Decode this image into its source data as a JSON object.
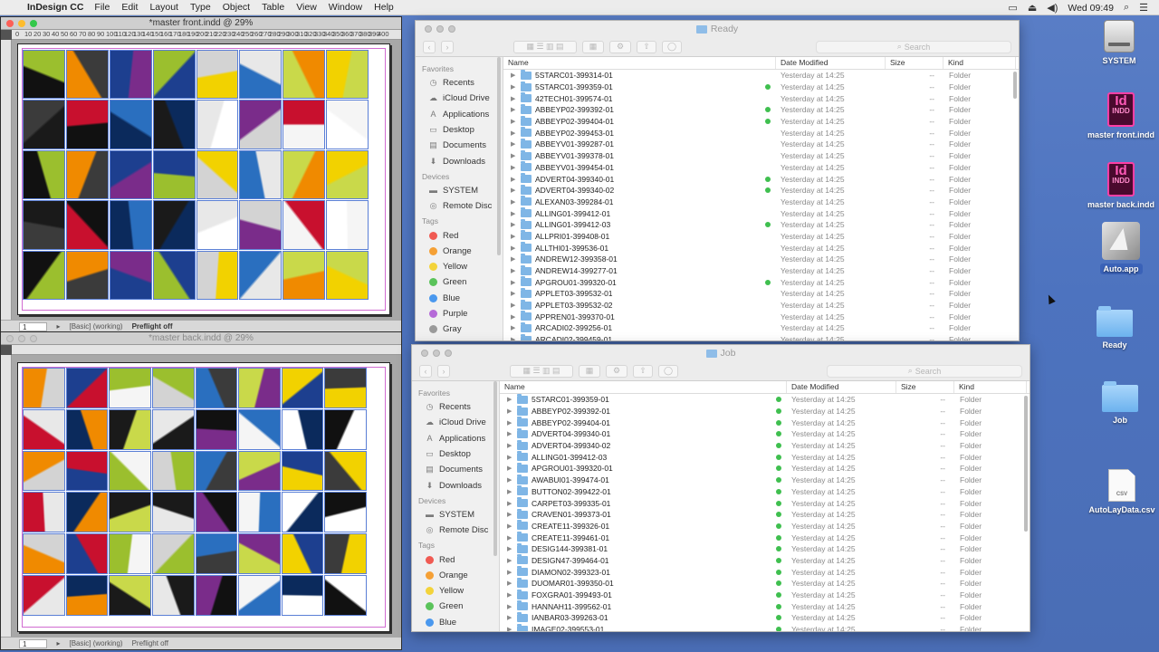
{
  "menubar": {
    "apple_icon": "apple-icon",
    "app_name": "InDesign CC",
    "items": [
      "File",
      "Edit",
      "Layout",
      "Type",
      "Object",
      "Table",
      "View",
      "Window",
      "Help"
    ],
    "clock": "Wed 09:49"
  },
  "indesign_front": {
    "title": "*master front.indd @ 29%",
    "page_number": "1",
    "style": "[Basic] (working)",
    "preflight": "Preflight off",
    "ruler": [
      "0",
      "10",
      "20",
      "30",
      "40",
      "50",
      "60",
      "70",
      "80",
      "90",
      "100",
      "110",
      "120",
      "130",
      "140",
      "150",
      "160",
      "170",
      "180",
      "190",
      "200",
      "210",
      "220",
      "230",
      "240",
      "250",
      "260",
      "270",
      "280",
      "290",
      "300",
      "310",
      "320",
      "330",
      "340",
      "350",
      "360",
      "370",
      "380",
      "390",
      "400"
    ]
  },
  "indesign_back": {
    "title": "*master back.indd @ 29%",
    "page_number": "1",
    "style": "[Basic] (working)",
    "preflight": "Preflight off"
  },
  "finder_ready": {
    "title": "Ready",
    "search_placeholder": "Search",
    "columns": {
      "name": "Name",
      "date": "Date Modified",
      "size": "Size",
      "kind": "Kind"
    },
    "rows": [
      {
        "name": "5STARC01-399314-01",
        "tag": false
      },
      {
        "name": "5STARC01-399359-01",
        "tag": true
      },
      {
        "name": "42TECH01-399574-01",
        "tag": false
      },
      {
        "name": "ABBEYP02-399392-01",
        "tag": true
      },
      {
        "name": "ABBEYP02-399404-01",
        "tag": true
      },
      {
        "name": "ABBEYP02-399453-01",
        "tag": false
      },
      {
        "name": "ABBEYV01-399287-01",
        "tag": false
      },
      {
        "name": "ABBEYV01-399378-01",
        "tag": false
      },
      {
        "name": "ABBEYV01-399454-01",
        "tag": false
      },
      {
        "name": "ADVERT04-399340-01",
        "tag": true
      },
      {
        "name": "ADVERT04-399340-02",
        "tag": true
      },
      {
        "name": "ALEXAN03-399284-01",
        "tag": false
      },
      {
        "name": "ALLING01-399412-01",
        "tag": false
      },
      {
        "name": "ALLING01-399412-03",
        "tag": true
      },
      {
        "name": "ALLPRI01-399408-01",
        "tag": false
      },
      {
        "name": "ALLTHI01-399536-01",
        "tag": false
      },
      {
        "name": "ANDREW12-399358-01",
        "tag": false
      },
      {
        "name": "ANDREW14-399277-01",
        "tag": false
      },
      {
        "name": "APGROU01-399320-01",
        "tag": true
      },
      {
        "name": "APPLET03-399532-01",
        "tag": false
      },
      {
        "name": "APPLET03-399532-02",
        "tag": false
      },
      {
        "name": "APPREN01-399370-01",
        "tag": false
      },
      {
        "name": "ARCADI02-399256-01",
        "tag": false
      },
      {
        "name": "ARCADI02-399459-01",
        "tag": false
      }
    ],
    "date_value": "Yesterday at 14:25",
    "size_value": "--",
    "kind_value": "Folder"
  },
  "finder_job": {
    "title": "Job",
    "search_placeholder": "Search",
    "columns": {
      "name": "Name",
      "date": "Date Modified",
      "size": "Size",
      "kind": "Kind"
    },
    "rows": [
      "5STARC01-399359-01",
      "ABBEYP02-399392-01",
      "ABBEYP02-399404-01",
      "ADVERT04-399340-01",
      "ADVERT04-399340-02",
      "ALLING01-399412-03",
      "APGROU01-399320-01",
      "AWABUI01-399474-01",
      "BUTTON02-399422-01",
      "CARPET03-399335-01",
      "CRAVEN01-399373-01",
      "CREATE11-399326-01",
      "CREATE11-399461-01",
      "DESIG144-399381-01",
      "DESIGN47-399464-01",
      "DIAMON02-399323-01",
      "DUOMAR01-399350-01",
      "FOXGRA01-399493-01",
      "HANNAH11-399562-01",
      "IANBAR03-399263-01",
      "IMAGE02-399553-01"
    ],
    "date_value": "Yesterday at 14:25",
    "size_value": "--",
    "kind_value": "Folder"
  },
  "sidebar": {
    "favorites_header": "Favorites",
    "favorites": [
      {
        "label": "Recents",
        "icon": "clock-icon"
      },
      {
        "label": "iCloud Drive",
        "icon": "cloud-icon"
      },
      {
        "label": "Applications",
        "icon": "applications-icon"
      },
      {
        "label": "Desktop",
        "icon": "desktop-icon"
      },
      {
        "label": "Documents",
        "icon": "document-icon"
      },
      {
        "label": "Downloads",
        "icon": "download-icon"
      }
    ],
    "devices_header": "Devices",
    "devices": [
      {
        "label": "SYSTEM",
        "icon": "disk-icon"
      },
      {
        "label": "Remote Disc",
        "icon": "disc-icon"
      }
    ],
    "tags_header": "Tags",
    "tags": [
      {
        "label": "Red",
        "color": "#f05a52"
      },
      {
        "label": "Orange",
        "color": "#f5a035"
      },
      {
        "label": "Yellow",
        "color": "#f3d33a"
      },
      {
        "label": "Green",
        "color": "#5ac35a"
      },
      {
        "label": "Blue",
        "color": "#4a98ee"
      },
      {
        "label": "Purple",
        "color": "#b56ad8"
      },
      {
        "label": "Gray",
        "color": "#9a9a9a"
      }
    ]
  },
  "desktop": {
    "icons": [
      {
        "label": "SYSTEM",
        "type": "disk"
      },
      {
        "label": "master front.indd",
        "type": "indd"
      },
      {
        "label": "master back.indd",
        "type": "indd"
      },
      {
        "label": "Auto.app",
        "type": "app"
      },
      {
        "label": "Ready",
        "type": "folder"
      },
      {
        "label": "Job",
        "type": "folder"
      },
      {
        "label": "AutoLayData.csv",
        "type": "csv"
      }
    ],
    "indd_badge": "INDD",
    "indd_letters": "Id",
    "csv_badge": "CSV"
  },
  "colors": {
    "tag_green": "#3fbf4f",
    "folder_blue": "#7fb6e6",
    "desktop_blue": "#4d73bf",
    "indesign_pink": "#ff3ea5"
  }
}
